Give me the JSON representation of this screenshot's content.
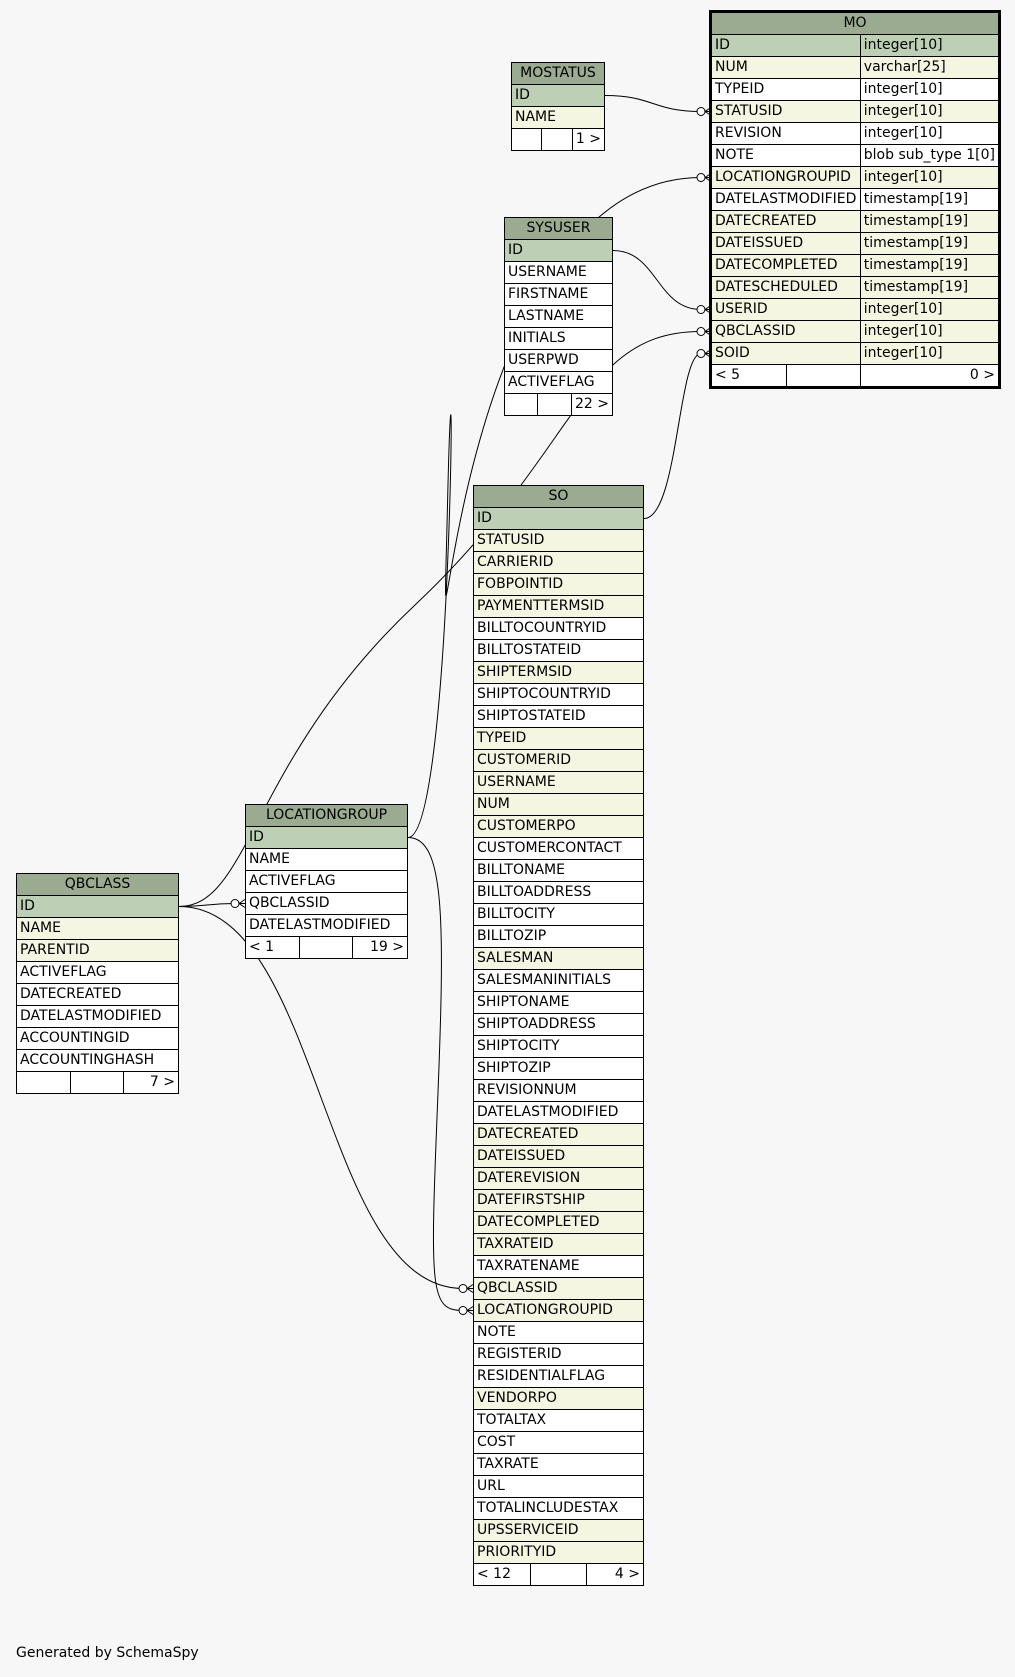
{
  "footer": "Generated by SchemaSpy",
  "tables": {
    "mo": {
      "name": "MO",
      "columns": [
        {
          "name": "ID",
          "type": "integer[10]",
          "kind": "pk"
        },
        {
          "name": "NUM",
          "type": "varchar[25]",
          "kind": "fk"
        },
        {
          "name": "TYPEID",
          "type": "integer[10]",
          "kind": "plain"
        },
        {
          "name": "STATUSID",
          "type": "integer[10]",
          "kind": "fk"
        },
        {
          "name": "REVISION",
          "type": "integer[10]",
          "kind": "plain"
        },
        {
          "name": "NOTE",
          "type": "blob sub_type 1[0]",
          "kind": "plain"
        },
        {
          "name": "LOCATIONGROUPID",
          "type": "integer[10]",
          "kind": "fk"
        },
        {
          "name": "DATELASTMODIFIED",
          "type": "timestamp[19]",
          "kind": "plain"
        },
        {
          "name": "DATECREATED",
          "type": "timestamp[19]",
          "kind": "fk"
        },
        {
          "name": "DATEISSUED",
          "type": "timestamp[19]",
          "kind": "fk"
        },
        {
          "name": "DATECOMPLETED",
          "type": "timestamp[19]",
          "kind": "fk"
        },
        {
          "name": "DATESCHEDULED",
          "type": "timestamp[19]",
          "kind": "fk"
        },
        {
          "name": "USERID",
          "type": "integer[10]",
          "kind": "fk"
        },
        {
          "name": "QBCLASSID",
          "type": "integer[10]",
          "kind": "fk"
        },
        {
          "name": "SOID",
          "type": "integer[10]",
          "kind": "fk"
        }
      ],
      "footer": [
        "< 5",
        "",
        "0 >"
      ]
    },
    "mostatus": {
      "name": "MOSTATUS",
      "columns": [
        {
          "name": "ID",
          "kind": "pk"
        },
        {
          "name": "NAME",
          "kind": "fk"
        }
      ],
      "footer": [
        "",
        "",
        "1 >"
      ]
    },
    "sysuser": {
      "name": "SYSUSER",
      "columns": [
        {
          "name": "ID",
          "kind": "pk"
        },
        {
          "name": "USERNAME",
          "kind": "plain"
        },
        {
          "name": "FIRSTNAME",
          "kind": "plain"
        },
        {
          "name": "LASTNAME",
          "kind": "plain"
        },
        {
          "name": "INITIALS",
          "kind": "plain"
        },
        {
          "name": "USERPWD",
          "kind": "plain"
        },
        {
          "name": "ACTIVEFLAG",
          "kind": "plain"
        }
      ],
      "footer": [
        "",
        "",
        "22 >"
      ]
    },
    "so": {
      "name": "SO",
      "columns": [
        {
          "name": "ID",
          "kind": "pk"
        },
        {
          "name": "STATUSID",
          "kind": "fk"
        },
        {
          "name": "CARRIERID",
          "kind": "fk"
        },
        {
          "name": "FOBPOINTID",
          "kind": "fk"
        },
        {
          "name": "PAYMENTTERMSID",
          "kind": "fk"
        },
        {
          "name": "BILLTOCOUNTRYID",
          "kind": "plain"
        },
        {
          "name": "BILLTOSTATEID",
          "kind": "plain"
        },
        {
          "name": "SHIPTERMSID",
          "kind": "fk"
        },
        {
          "name": "SHIPTOCOUNTRYID",
          "kind": "plain"
        },
        {
          "name": "SHIPTOSTATEID",
          "kind": "plain"
        },
        {
          "name": "TYPEID",
          "kind": "fk"
        },
        {
          "name": "CUSTOMERID",
          "kind": "fk"
        },
        {
          "name": "USERNAME",
          "kind": "fk"
        },
        {
          "name": "NUM",
          "kind": "fk"
        },
        {
          "name": "CUSTOMERPO",
          "kind": "fk"
        },
        {
          "name": "CUSTOMERCONTACT",
          "kind": "plain"
        },
        {
          "name": "BILLTONAME",
          "kind": "plain"
        },
        {
          "name": "BILLTOADDRESS",
          "kind": "plain"
        },
        {
          "name": "BILLTOCITY",
          "kind": "plain"
        },
        {
          "name": "BILLTOZIP",
          "kind": "plain"
        },
        {
          "name": "SALESMAN",
          "kind": "fk"
        },
        {
          "name": "SALESMANINITIALS",
          "kind": "plain"
        },
        {
          "name": "SHIPTONAME",
          "kind": "plain"
        },
        {
          "name": "SHIPTOADDRESS",
          "kind": "plain"
        },
        {
          "name": "SHIPTOCITY",
          "kind": "plain"
        },
        {
          "name": "SHIPTOZIP",
          "kind": "plain"
        },
        {
          "name": "REVISIONNUM",
          "kind": "plain"
        },
        {
          "name": "DATELASTMODIFIED",
          "kind": "plain"
        },
        {
          "name": "DATECREATED",
          "kind": "fk"
        },
        {
          "name": "DATEISSUED",
          "kind": "fk"
        },
        {
          "name": "DATEREVISION",
          "kind": "fk"
        },
        {
          "name": "DATEFIRSTSHIP",
          "kind": "fk"
        },
        {
          "name": "DATECOMPLETED",
          "kind": "fk"
        },
        {
          "name": "TAXRATEID",
          "kind": "fk"
        },
        {
          "name": "TAXRATENAME",
          "kind": "plain"
        },
        {
          "name": "QBCLASSID",
          "kind": "fk"
        },
        {
          "name": "LOCATIONGROUPID",
          "kind": "fk"
        },
        {
          "name": "NOTE",
          "kind": "plain"
        },
        {
          "name": "REGISTERID",
          "kind": "plain"
        },
        {
          "name": "RESIDENTIALFLAG",
          "kind": "plain"
        },
        {
          "name": "VENDORPO",
          "kind": "fk"
        },
        {
          "name": "TOTALTAX",
          "kind": "plain"
        },
        {
          "name": "COST",
          "kind": "plain"
        },
        {
          "name": "TAXRATE",
          "kind": "plain"
        },
        {
          "name": "URL",
          "kind": "plain"
        },
        {
          "name": "TOTALINCLUDESTAX",
          "kind": "plain"
        },
        {
          "name": "UPSSERVICEID",
          "kind": "fk"
        },
        {
          "name": "PRIORITYID",
          "kind": "fk"
        }
      ],
      "footer": [
        "< 12",
        "",
        "4 >"
      ]
    },
    "locationgroup": {
      "name": "LOCATIONGROUP",
      "columns": [
        {
          "name": "ID",
          "kind": "pk"
        },
        {
          "name": "NAME",
          "kind": "plain"
        },
        {
          "name": "ACTIVEFLAG",
          "kind": "plain"
        },
        {
          "name": "QBCLASSID",
          "kind": "plain"
        },
        {
          "name": "DATELASTMODIFIED",
          "kind": "plain"
        }
      ],
      "footer": [
        "< 1",
        "",
        "19 >"
      ]
    },
    "qbclass": {
      "name": "QBCLASS",
      "columns": [
        {
          "name": "ID",
          "kind": "pk"
        },
        {
          "name": "NAME",
          "kind": "fk"
        },
        {
          "name": "PARENTID",
          "kind": "fk"
        },
        {
          "name": "ACTIVEFLAG",
          "kind": "plain"
        },
        {
          "name": "DATECREATED",
          "kind": "plain"
        },
        {
          "name": "DATELASTMODIFIED",
          "kind": "plain"
        },
        {
          "name": "ACCOUNTINGID",
          "kind": "plain"
        },
        {
          "name": "ACCOUNTINGHASH",
          "kind": "plain"
        }
      ],
      "footer": [
        "",
        "",
        "7 >"
      ]
    }
  },
  "relationships": [
    {
      "from": "mostatus.ID",
      "to": "mo.STATUSID"
    },
    {
      "from": "locationgroup.ID",
      "to": "mo.LOCATIONGROUPID"
    },
    {
      "from": "sysuser.ID",
      "to": "mo.USERID"
    },
    {
      "from": "qbclass.ID",
      "to": "mo.QBCLASSID"
    },
    {
      "from": "so.ID",
      "to": "mo.SOID"
    },
    {
      "from": "qbclass.ID",
      "to": "locationgroup.QBCLASSID"
    },
    {
      "from": "qbclass.ID",
      "to": "so.QBCLASSID"
    },
    {
      "from": "locationgroup.ID",
      "to": "so.LOCATIONGROUPID"
    }
  ]
}
